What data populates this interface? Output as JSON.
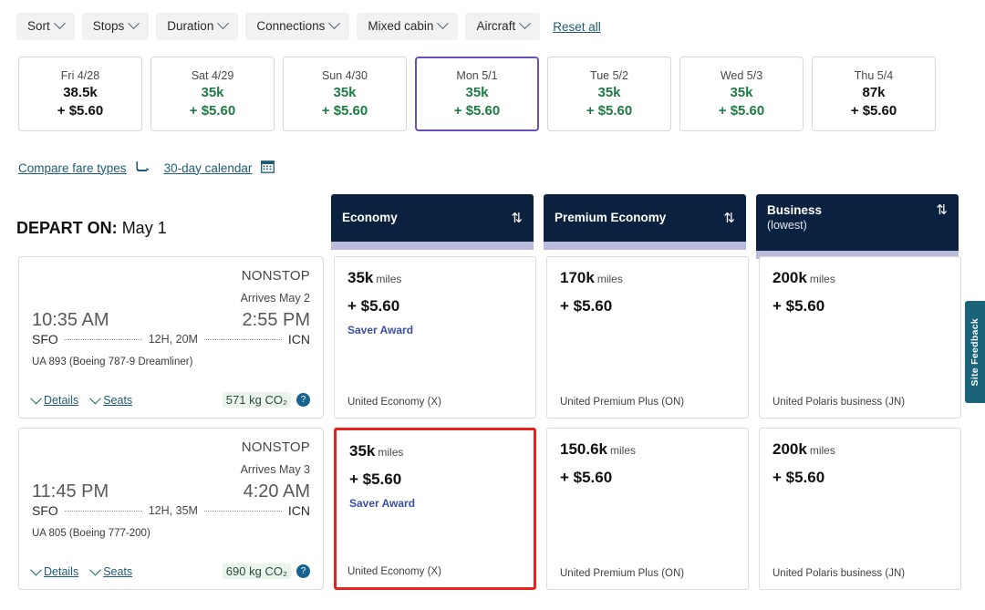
{
  "filters": {
    "chips": [
      "Sort",
      "Stops",
      "Duration",
      "Connections",
      "Mixed cabin",
      "Aircraft"
    ],
    "reset_label": "Reset all"
  },
  "date_strip": [
    {
      "dow": "Fri 4/28",
      "miles": "38.5k",
      "cash": "+ $5.60",
      "deal": false,
      "selected": false
    },
    {
      "dow": "Sat 4/29",
      "miles": "35k",
      "cash": "+ $5.60",
      "deal": true,
      "selected": false
    },
    {
      "dow": "Sun 4/30",
      "miles": "35k",
      "cash": "+ $5.60",
      "deal": true,
      "selected": false
    },
    {
      "dow": "Mon 5/1",
      "miles": "35k",
      "cash": "+ $5.60",
      "deal": true,
      "selected": true
    },
    {
      "dow": "Tue 5/2",
      "miles": "35k",
      "cash": "+ $5.60",
      "deal": true,
      "selected": false
    },
    {
      "dow": "Wed 5/3",
      "miles": "35k",
      "cash": "+ $5.60",
      "deal": true,
      "selected": false
    },
    {
      "dow": "Thu 5/4",
      "miles": "87k",
      "cash": "+ $5.60",
      "deal": false,
      "selected": false
    }
  ],
  "links": {
    "compare": "Compare fare types",
    "calendar": "30-day calendar"
  },
  "depart": {
    "label": "DEPART ON:",
    "date": "May 1"
  },
  "columns": [
    {
      "title": "Economy",
      "sub": "",
      "sort_icon": "sort-updown-icon"
    },
    {
      "title": "Premium Economy",
      "sub": "",
      "sort_icon": "sort-updown-icon"
    },
    {
      "title": "Business",
      "sub": "(lowest)",
      "sort_icon": "sort-updown-icon"
    }
  ],
  "flights": [
    {
      "stops": "NONSTOP",
      "arrives": "Arrives May 2",
      "depart_time": "10:35 AM",
      "arrive_time": "2:55 PM",
      "origin": "SFO",
      "destination": "ICN",
      "duration": "12H, 20M",
      "equipment": "UA 893 (Boeing 787-9 Dreamliner)",
      "details_label": "Details",
      "seats_label": "Seats",
      "co2": "571 kg CO₂",
      "fares": [
        {
          "miles": "35k",
          "unit": "miles",
          "cash": "+ $5.60",
          "tag": "Saver Award",
          "class": "United Economy (X)",
          "flagged": false
        },
        {
          "miles": "170k",
          "unit": "miles",
          "cash": "+ $5.60",
          "tag": "",
          "class": "United Premium Plus (ON)",
          "flagged": false
        },
        {
          "miles": "200k",
          "unit": "miles",
          "cash": "+ $5.60",
          "tag": "",
          "class": "United Polaris business (JN)",
          "flagged": false
        }
      ]
    },
    {
      "stops": "NONSTOP",
      "arrives": "Arrives May 3",
      "depart_time": "11:45 PM",
      "arrive_time": "4:20 AM",
      "origin": "SFO",
      "destination": "ICN",
      "duration": "12H, 35M",
      "equipment": "UA 805 (Boeing 777-200)",
      "details_label": "Details",
      "seats_label": "Seats",
      "co2": "690 kg CO₂",
      "fares": [
        {
          "miles": "35k",
          "unit": "miles",
          "cash": "+ $5.60",
          "tag": "Saver Award",
          "class": "United Economy (X)",
          "flagged": true
        },
        {
          "miles": "150.6k",
          "unit": "miles",
          "cash": "+ $5.60",
          "tag": "",
          "class": "United Premium Plus (ON)",
          "flagged": false
        },
        {
          "miles": "200k",
          "unit": "miles",
          "cash": "+ $5.60",
          "tag": "",
          "class": "United Polaris business (JN)",
          "flagged": false
        }
      ]
    }
  ],
  "feedback": {
    "label": "Site Feedback"
  },
  "colors": {
    "header_navy": "#0a2240",
    "deal_green": "#1f7a43",
    "selected_purple": "#6b4fbb",
    "link_teal": "#1f5c73",
    "flag_red": "#e8231f",
    "saver_blue": "#3b4ea0",
    "feedback_teal": "#1b6379",
    "underbar_lavender": "#b9bcdd"
  }
}
